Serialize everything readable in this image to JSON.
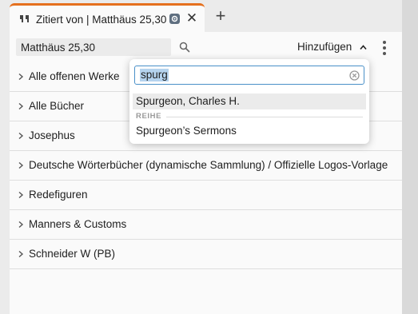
{
  "tab": {
    "title": "Zitiert von | Matthäus 25,30",
    "close_glyph": "✕",
    "add_glyph": "+",
    "accent_color": "#e5701e",
    "icons": [
      "quote-icon",
      "sync-icon",
      "close-icon",
      "plus-icon"
    ]
  },
  "toolbar": {
    "reference_value": "Matthäus 25,30",
    "add_label": "Hinzufügen",
    "icons": [
      "search-icon",
      "chevron-up-icon",
      "kebab-menu-icon"
    ]
  },
  "list": {
    "items": [
      {
        "label": "Alle offenen Werke"
      },
      {
        "label": "Alle Bücher"
      },
      {
        "label": "Josephus"
      },
      {
        "label": "Deutsche Wörterbücher (dynamische Sammlung) / Offizielle Logos-Vorlage"
      },
      {
        "label": "Redefiguren"
      },
      {
        "label": "Manners & Customs"
      },
      {
        "label": "Schneider W (PB)"
      }
    ]
  },
  "dropdown": {
    "query": "spurg",
    "results": [
      {
        "label": "Spurgeon, Charles H.",
        "highlighted": true
      }
    ],
    "section_label": "REIHE",
    "section_results": [
      {
        "label": "Spurgeon’s Sermons"
      }
    ]
  }
}
